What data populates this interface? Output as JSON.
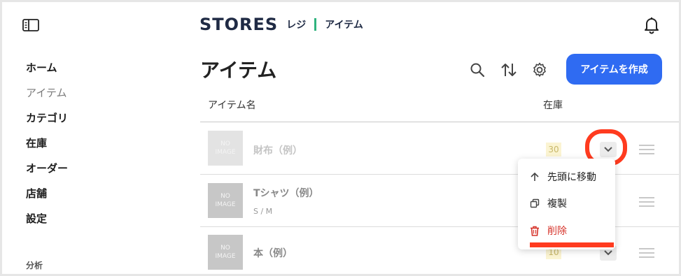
{
  "header": {
    "brand": "STORES",
    "brand_sub": "レジ",
    "page": "アイテム"
  },
  "sidebar": {
    "items": [
      {
        "label": "ホーム"
      },
      {
        "label": "アイテム"
      },
      {
        "label": "カテゴリ"
      },
      {
        "label": "在庫"
      },
      {
        "label": "オーダー"
      },
      {
        "label": "店舗"
      },
      {
        "label": "設定"
      }
    ],
    "section": "分析"
  },
  "main": {
    "title": "アイテム",
    "create_button": "アイテムを作成",
    "columns": {
      "name": "アイテム名",
      "stock": "在庫"
    },
    "items": [
      {
        "name": "財布（例）",
        "sub": "",
        "stock": "30",
        "image": [
          "NO",
          "IMAGE"
        ]
      },
      {
        "name": "Tシャツ（例）",
        "sub": "S / M",
        "stock": "",
        "image": [
          "NO",
          "IMAGE"
        ]
      },
      {
        "name": "本（例）",
        "sub": "",
        "stock": "10",
        "image": [
          "NO",
          "IMAGE"
        ]
      }
    ]
  },
  "menu": {
    "items": [
      {
        "label": "先頭に移動",
        "icon": "arrow-up-icon"
      },
      {
        "label": "複製",
        "icon": "copy-icon"
      },
      {
        "label": "削除",
        "icon": "trash-icon"
      }
    ]
  },
  "colors": {
    "accent": "#2f6bf2",
    "brand_divider": "#2fb37e",
    "danger": "#d6332a",
    "annotation": "#ff3b1f"
  }
}
